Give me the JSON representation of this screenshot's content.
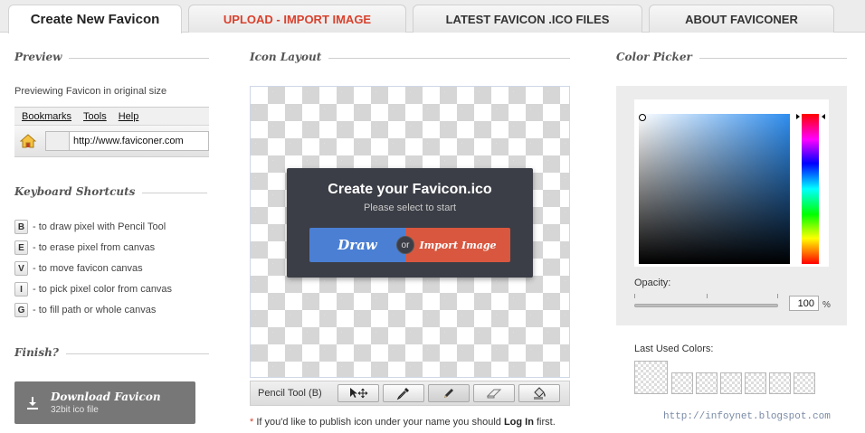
{
  "tabs": [
    {
      "label": "Create New Favicon",
      "active": true
    },
    {
      "label": "UPLOAD - IMPORT IMAGE",
      "active": false
    },
    {
      "label": "LATEST FAVICON .ICO FILES",
      "active": false
    },
    {
      "label": "ABOUT FAVICONER",
      "active": false
    }
  ],
  "preview": {
    "heading": "Preview",
    "caption": "Previewing Favicon in original size",
    "menu": [
      "Bookmarks",
      "Tools",
      "Help"
    ],
    "url": "http://www.faviconer.com"
  },
  "shortcuts": {
    "heading": "Keyboard Shortcuts",
    "items": [
      {
        "key": "B",
        "text": "- to draw pixel with Pencil Tool"
      },
      {
        "key": "E",
        "text": "- to erase pixel from canvas"
      },
      {
        "key": "V",
        "text": "- to move favicon canvas"
      },
      {
        "key": "I",
        "text": "- to pick pixel color from canvas"
      },
      {
        "key": "G",
        "text": "- to fill path or whole canvas"
      }
    ]
  },
  "finish": {
    "heading": "Finish?",
    "download_label": "Download Favicon",
    "download_sub": "32bit ico file"
  },
  "layout": {
    "heading": "Icon Layout",
    "modal_title": "Create your Favicon.ico",
    "modal_subtitle": "Please select to start",
    "draw_label": "Draw",
    "or_label": "or",
    "import_label": "Import Image",
    "tool_label": "Pencil Tool (B)",
    "tools": [
      "move-icon",
      "eyedropper-icon",
      "pencil-icon",
      "eraser-icon",
      "fill-bucket-icon"
    ],
    "active_tool": "pencil-icon",
    "note_star": "*",
    "note_text": " If you'd like to publish icon under your name you should ",
    "note_login": "Log In",
    "note_end": " first."
  },
  "color_picker": {
    "heading": "Color Picker",
    "opacity_label": "Opacity:",
    "opacity_value": "100",
    "opacity_unit": "%",
    "last_used_label": "Last Used Colors:",
    "hue_color": "#2f8ef0"
  },
  "credit": "http://infoynet.blogspot.com"
}
